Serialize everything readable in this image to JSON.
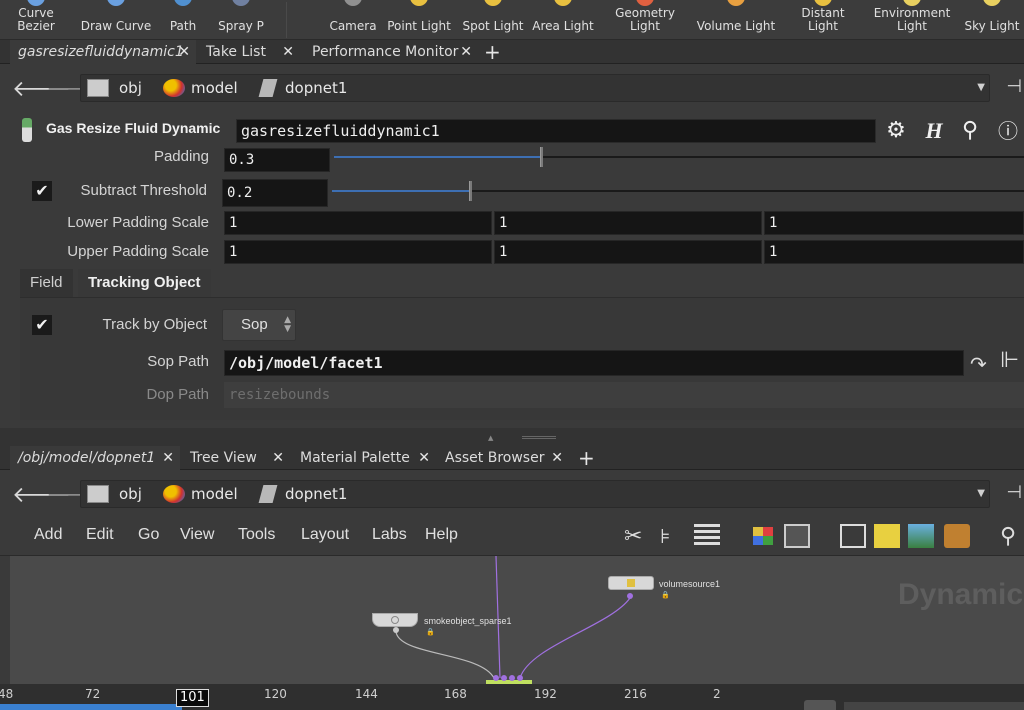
{
  "shelf": {
    "tools": [
      {
        "label": "Curve Bezier",
        "icon": "curve-bezier-icon"
      },
      {
        "label": "Draw Curve",
        "icon": "draw-curve-icon"
      },
      {
        "label": "Path",
        "icon": "path-icon"
      },
      {
        "label": "Spray P",
        "icon": "spray-paint-icon"
      },
      {
        "label": "Camera",
        "icon": "camera-icon"
      },
      {
        "label": "Point Light",
        "icon": "point-light-icon"
      },
      {
        "label": "Spot Light",
        "icon": "spot-light-icon"
      },
      {
        "label": "Area Light",
        "icon": "area-light-icon"
      },
      {
        "label": "Geometry\nLight",
        "icon": "geometry-light-icon"
      },
      {
        "label": "Volume Light",
        "icon": "volume-light-icon"
      },
      {
        "label": "Distant\nLight",
        "icon": "distant-light-icon"
      },
      {
        "label": "Environment\nLight",
        "icon": "environment-light-icon"
      },
      {
        "label": "Sky Light",
        "icon": "sky-light-icon"
      }
    ]
  },
  "top_tabs": [
    {
      "label": "gasresizefluiddynamic1",
      "active": true
    },
    {
      "label": "Take List",
      "active": false
    },
    {
      "label": "Performance Monitor",
      "active": false
    }
  ],
  "top_path": {
    "crumbs": [
      "obj",
      "model",
      "dopnet1"
    ]
  },
  "parm_header": {
    "node_type": "Gas Resize Fluid Dynamic",
    "node_name": "gasresizefluiddynamic1"
  },
  "parms": {
    "padding": {
      "label": "Padding",
      "value": "0.3",
      "slider_fraction": 0.3
    },
    "subtract_threshold": {
      "label": "Subtract Threshold",
      "value": "0.2",
      "checked": true,
      "slider_fraction": 0.2
    },
    "lower_padding_scale": {
      "label": "Lower Padding Scale",
      "values": [
        "1",
        "1",
        "1"
      ]
    },
    "upper_padding_scale": {
      "label": "Upper Padding Scale",
      "values": [
        "1",
        "1",
        "1"
      ]
    },
    "subtabs": [
      "Field",
      "Tracking Object"
    ],
    "active_subtab": "Tracking Object",
    "track_by_object": {
      "label": "Track by Object",
      "value": "Sop",
      "checked": true
    },
    "sop_path": {
      "label": "Sop Path",
      "value": "/obj/model/facet1"
    },
    "dop_path": {
      "label": "Dop Path",
      "value": "resizebounds"
    }
  },
  "bottom_tabs": [
    {
      "label": "/obj/model/dopnet1",
      "active": true
    },
    {
      "label": "Tree View",
      "active": false
    },
    {
      "label": "Material Palette",
      "active": false
    },
    {
      "label": "Asset Browser",
      "active": false
    }
  ],
  "bottom_path": {
    "crumbs": [
      "obj",
      "model",
      "dopnet1"
    ]
  },
  "network_menu": [
    "Add",
    "Edit",
    "Go",
    "View",
    "Tools",
    "Layout",
    "Labs",
    "Help"
  ],
  "network": {
    "watermark": "Dynamic",
    "nodes": [
      {
        "name": "volumesource1"
      },
      {
        "name": "smokeobject_sparse1"
      }
    ]
  },
  "timeline": {
    "ticks": [
      "48",
      "72",
      "120",
      "144",
      "168",
      "192",
      "216",
      "2"
    ],
    "current_frame": "101"
  },
  "colors": {
    "accent": "#3d6fb3",
    "wire": "#a070e0",
    "background": "#3a3a3a"
  }
}
